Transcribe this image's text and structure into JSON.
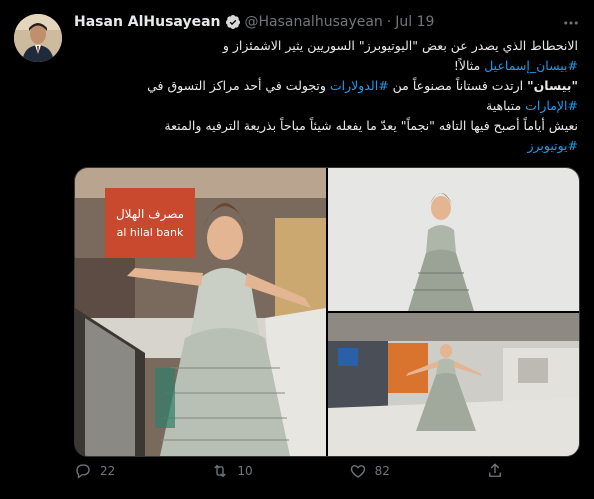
{
  "tweet": {
    "author": {
      "display_name": "Hasan AlHusayean",
      "handle": "@Hasanalhusayean",
      "verified": true
    },
    "separator": "·",
    "date": "Jul 19",
    "text_lines": [
      {
        "parts": [
          {
            "t": "الانحطاط الذي يصدر عن بعض \"اليوتيوبرز\" السوريين يثير الاشمئزاز و"
          }
        ]
      },
      {
        "parts": [
          {
            "t": "#بيسان_إسماعيل",
            "type": "hashtag"
          },
          {
            "t": " مثالاً!"
          }
        ]
      },
      {
        "parts": [
          {
            "t": "\"بيسان\"",
            "type": "bold"
          },
          {
            "t": " ارتدت فستاناً مصنوعاً من "
          },
          {
            "t": "#الدولارات",
            "type": "hashtag"
          },
          {
            "t": " وتجولت في أحد مراكز التسوق في"
          }
        ]
      },
      {
        "parts": [
          {
            "t": "#الإمارات",
            "type": "hashtag"
          },
          {
            "t": " متباهية"
          }
        ]
      },
      {
        "parts": [
          {
            "t": "نعيش أياماً أصبح فيها التافه \"نجماً\"  يعدّ ما يفعله شيئاً مباحاً بذريعة الترفيه والمتعة"
          }
        ]
      },
      {
        "parts": [
          {
            "t": "#يوتيوبرز",
            "type": "hashtag"
          }
        ]
      }
    ],
    "media": {
      "images": [
        {
          "name": "photo-mall-escalator",
          "desc_visible_text": "مصرف الهلال al hilal bank"
        },
        {
          "name": "photo-studio-portrait"
        },
        {
          "name": "photo-mall-hall"
        }
      ]
    },
    "actions": {
      "replies": "22",
      "retweets": "10",
      "likes": "82"
    },
    "icons": {
      "reply": "reply-icon",
      "retweet": "retweet-icon",
      "like": "heart-icon",
      "share": "share-icon",
      "more": "more-icon",
      "verified": "verified-badge-icon"
    },
    "colors": {
      "background": "#000000",
      "text": "#e7e9ea",
      "muted": "#71767b",
      "link": "#1d9bf0",
      "border": "#333639"
    }
  }
}
